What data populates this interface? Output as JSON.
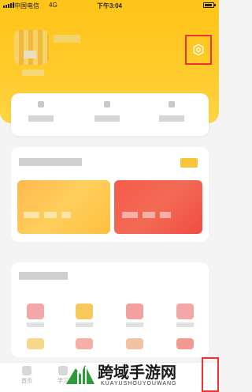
{
  "status_bar": {
    "carrier": "中国电信",
    "network": "4G",
    "time": "下午3:04"
  },
  "header": {
    "settings_icon": "gear-icon"
  },
  "colors": {
    "brand_yellow": "#ffc51a",
    "highlight_red": "#e33333",
    "promo_orange": "#ffb84d",
    "promo_red": "#f45c4a"
  },
  "bottom_nav": {
    "items": [
      {
        "label": "首页",
        "icon": "home-icon"
      },
      {
        "label": "学习",
        "icon": "study-icon"
      }
    ]
  },
  "watermark": {
    "title": "跨域手游网",
    "subtitle": "KUAYUSHOUYOUWANG"
  }
}
